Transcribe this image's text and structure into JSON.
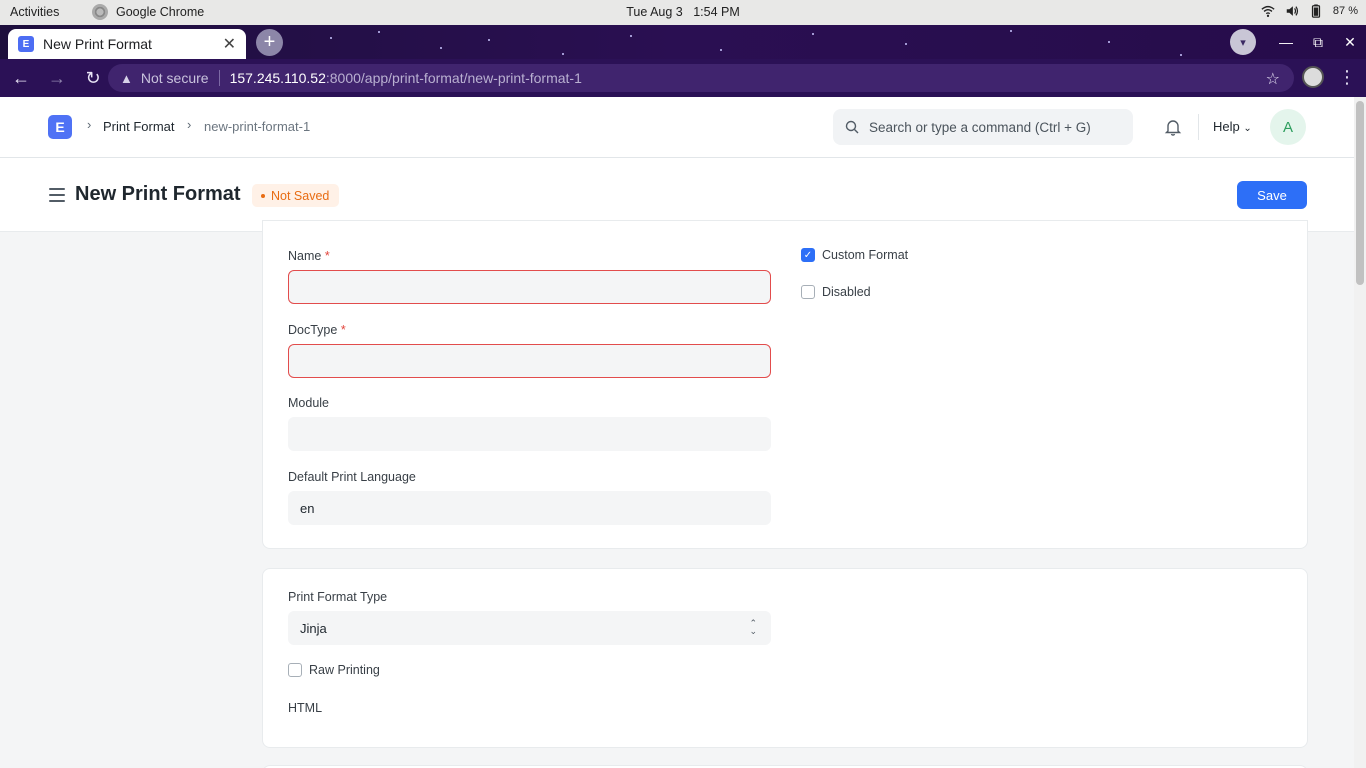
{
  "os": {
    "activities": "Activities",
    "app_name": "Google Chrome",
    "date": "Tue Aug 3",
    "time": "1:54 PM",
    "battery": "87 %"
  },
  "browser": {
    "tab_title": "New Print Format",
    "not_secure": "Not secure",
    "url_host": "157.245.110.52",
    "url_path": ":8000/app/print-format/new-print-format-1"
  },
  "navbar": {
    "logo_letter": "E",
    "breadcrumb": [
      "Print Format",
      "new-print-format-1"
    ],
    "search_placeholder": "Search or type a command (Ctrl + G)",
    "help": "Help",
    "avatar_letter": "A"
  },
  "page": {
    "title": "New Print Format",
    "status": "Not Saved",
    "save_label": "Save"
  },
  "form": {
    "name_label": "Name",
    "name_value": "",
    "doctype_label": "DocType",
    "doctype_value": "",
    "module_label": "Module",
    "module_value": "",
    "language_label": "Default Print Language",
    "language_value": "en",
    "custom_format_label": "Custom Format",
    "custom_format_checked": true,
    "disabled_label": "Disabled",
    "disabled_checked": false,
    "print_format_type_label": "Print Format Type",
    "print_format_type_value": "Jinja",
    "raw_printing_label": "Raw Printing",
    "raw_printing_checked": false,
    "html_label": "HTML"
  },
  "colors": {
    "primary": "#2d6ff7",
    "error": "#e24c4c",
    "warning": "#e86c13",
    "chrome_theme": "#2b1156"
  }
}
